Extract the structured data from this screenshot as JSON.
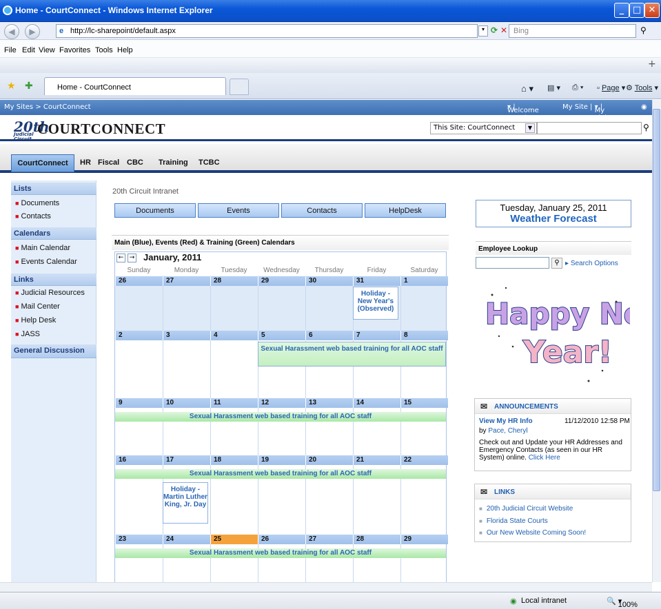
{
  "window": {
    "title": "Home - CourtConnect - Windows Internet Explorer"
  },
  "address": {
    "url": "http://lc-sharepoint/default.aspx",
    "search_placeholder": "Bing"
  },
  "menu": [
    "File",
    "Edit",
    "View",
    "Favorites",
    "Tools",
    "Help"
  ],
  "tab": {
    "title": "Home - CourtConnect"
  },
  "commandbar": {
    "page": "Page",
    "tools": "Tools"
  },
  "sharepoint": {
    "breadcrumb": "My Sites > CourtConnect",
    "welcome": "Welcome cttech",
    "my_site": "My Site",
    "my_links": "My Links",
    "logo_num": "20th",
    "logo_sub1": "Judicial",
    "logo_sub2": "Circuit",
    "brand": "CourtConnect",
    "scope": "This Site: CourtConnect"
  },
  "tabs": [
    "CourtConnect",
    "HR",
    "Fiscal",
    "CBC",
    "Training",
    "TCBC"
  ],
  "leftnav": {
    "lists": "Lists",
    "documents": "Documents",
    "contacts": "Contacts",
    "calendars": "Calendars",
    "main_cal": "Main Calendar",
    "events_cal": "Events Calendar",
    "links": "Links",
    "judicial": "Judicial Resources",
    "mail": "Mail Center",
    "help": "Help Desk",
    "jass": "JASS",
    "general": "General Discussion"
  },
  "main": {
    "intranet": "20th Circuit Intranet",
    "buttons": [
      "Documents",
      "Events",
      "Contacts",
      "HelpDesk"
    ],
    "cal_header": "Main (Blue), Events (Red) & Training (Green) Calendars",
    "month": "January, 2011",
    "days": [
      "Sunday",
      "Monday",
      "Tuesday",
      "Wednesday",
      "Thursday",
      "Friday",
      "Saturday"
    ],
    "weeks": [
      [
        "26",
        "27",
        "28",
        "29",
        "30",
        "31",
        "1"
      ],
      [
        "2",
        "3",
        "4",
        "5",
        "6",
        "7",
        "8"
      ],
      [
        "9",
        "10",
        "11",
        "12",
        "13",
        "14",
        "15"
      ],
      [
        "16",
        "17",
        "18",
        "19",
        "20",
        "21",
        "22"
      ],
      [
        "23",
        "24",
        "25",
        "26",
        "27",
        "28",
        "29"
      ]
    ],
    "ev_newyear": "Holiday - New Year's (Observed)",
    "ev_training": "Sexual Harassment web based training for all AOC staff",
    "ev_mlk": "Holiday - Martin Luther King, Jr. Day"
  },
  "right": {
    "date": "Tuesday, January 25, 2011",
    "weather": "Weather Forecast",
    "employee": "Employee Lookup",
    "search_options": "Search Options",
    "announcements": "ANNOUNCEMENTS",
    "ann_title": "View My HR Info",
    "ann_date": "11/12/2010 12:58 PM",
    "ann_by": "by",
    "ann_author": "Pace, Cheryl",
    "ann_body": "Check out and Update your HR Addresses and Emergency Contacts (as seen in our HR System) online.",
    "ann_link": "Click Here",
    "links_title": "LINKS",
    "links": [
      "20th Judicial Circuit Website",
      "Florida State Courts",
      "Our New Website Coming Soon!"
    ],
    "hny_line1": "Happy New",
    "hny_line2": "Year!"
  },
  "status": {
    "zone": "Local intranet",
    "zoom": "100%"
  }
}
